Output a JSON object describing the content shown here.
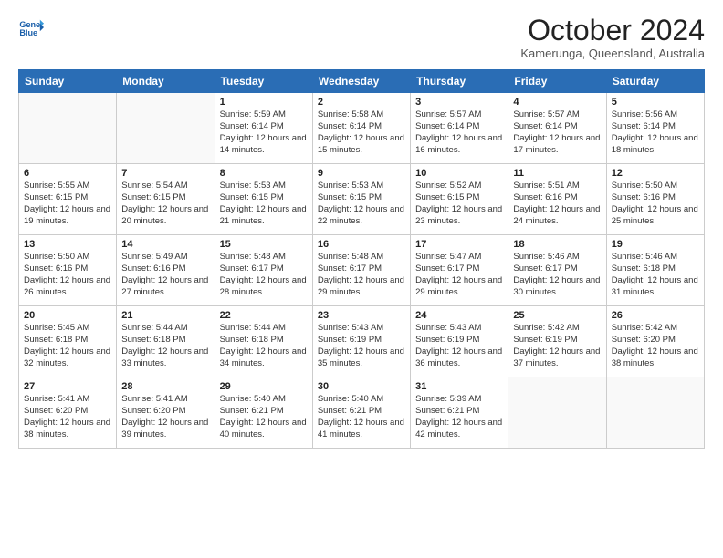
{
  "logo": {
    "line1": "General",
    "line2": "Blue"
  },
  "title": "October 2024",
  "subtitle": "Kamerunga, Queensland, Australia",
  "headers": [
    "Sunday",
    "Monday",
    "Tuesday",
    "Wednesday",
    "Thursday",
    "Friday",
    "Saturday"
  ],
  "weeks": [
    [
      {
        "day": "",
        "info": ""
      },
      {
        "day": "",
        "info": ""
      },
      {
        "day": "1",
        "info": "Sunrise: 5:59 AM\nSunset: 6:14 PM\nDaylight: 12 hours and 14 minutes."
      },
      {
        "day": "2",
        "info": "Sunrise: 5:58 AM\nSunset: 6:14 PM\nDaylight: 12 hours and 15 minutes."
      },
      {
        "day": "3",
        "info": "Sunrise: 5:57 AM\nSunset: 6:14 PM\nDaylight: 12 hours and 16 minutes."
      },
      {
        "day": "4",
        "info": "Sunrise: 5:57 AM\nSunset: 6:14 PM\nDaylight: 12 hours and 17 minutes."
      },
      {
        "day": "5",
        "info": "Sunrise: 5:56 AM\nSunset: 6:14 PM\nDaylight: 12 hours and 18 minutes."
      }
    ],
    [
      {
        "day": "6",
        "info": "Sunrise: 5:55 AM\nSunset: 6:15 PM\nDaylight: 12 hours and 19 minutes."
      },
      {
        "day": "7",
        "info": "Sunrise: 5:54 AM\nSunset: 6:15 PM\nDaylight: 12 hours and 20 minutes."
      },
      {
        "day": "8",
        "info": "Sunrise: 5:53 AM\nSunset: 6:15 PM\nDaylight: 12 hours and 21 minutes."
      },
      {
        "day": "9",
        "info": "Sunrise: 5:53 AM\nSunset: 6:15 PM\nDaylight: 12 hours and 22 minutes."
      },
      {
        "day": "10",
        "info": "Sunrise: 5:52 AM\nSunset: 6:15 PM\nDaylight: 12 hours and 23 minutes."
      },
      {
        "day": "11",
        "info": "Sunrise: 5:51 AM\nSunset: 6:16 PM\nDaylight: 12 hours and 24 minutes."
      },
      {
        "day": "12",
        "info": "Sunrise: 5:50 AM\nSunset: 6:16 PM\nDaylight: 12 hours and 25 minutes."
      }
    ],
    [
      {
        "day": "13",
        "info": "Sunrise: 5:50 AM\nSunset: 6:16 PM\nDaylight: 12 hours and 26 minutes."
      },
      {
        "day": "14",
        "info": "Sunrise: 5:49 AM\nSunset: 6:16 PM\nDaylight: 12 hours and 27 minutes."
      },
      {
        "day": "15",
        "info": "Sunrise: 5:48 AM\nSunset: 6:17 PM\nDaylight: 12 hours and 28 minutes."
      },
      {
        "day": "16",
        "info": "Sunrise: 5:48 AM\nSunset: 6:17 PM\nDaylight: 12 hours and 29 minutes."
      },
      {
        "day": "17",
        "info": "Sunrise: 5:47 AM\nSunset: 6:17 PM\nDaylight: 12 hours and 29 minutes."
      },
      {
        "day": "18",
        "info": "Sunrise: 5:46 AM\nSunset: 6:17 PM\nDaylight: 12 hours and 30 minutes."
      },
      {
        "day": "19",
        "info": "Sunrise: 5:46 AM\nSunset: 6:18 PM\nDaylight: 12 hours and 31 minutes."
      }
    ],
    [
      {
        "day": "20",
        "info": "Sunrise: 5:45 AM\nSunset: 6:18 PM\nDaylight: 12 hours and 32 minutes."
      },
      {
        "day": "21",
        "info": "Sunrise: 5:44 AM\nSunset: 6:18 PM\nDaylight: 12 hours and 33 minutes."
      },
      {
        "day": "22",
        "info": "Sunrise: 5:44 AM\nSunset: 6:18 PM\nDaylight: 12 hours and 34 minutes."
      },
      {
        "day": "23",
        "info": "Sunrise: 5:43 AM\nSunset: 6:19 PM\nDaylight: 12 hours and 35 minutes."
      },
      {
        "day": "24",
        "info": "Sunrise: 5:43 AM\nSunset: 6:19 PM\nDaylight: 12 hours and 36 minutes."
      },
      {
        "day": "25",
        "info": "Sunrise: 5:42 AM\nSunset: 6:19 PM\nDaylight: 12 hours and 37 minutes."
      },
      {
        "day": "26",
        "info": "Sunrise: 5:42 AM\nSunset: 6:20 PM\nDaylight: 12 hours and 38 minutes."
      }
    ],
    [
      {
        "day": "27",
        "info": "Sunrise: 5:41 AM\nSunset: 6:20 PM\nDaylight: 12 hours and 38 minutes."
      },
      {
        "day": "28",
        "info": "Sunrise: 5:41 AM\nSunset: 6:20 PM\nDaylight: 12 hours and 39 minutes."
      },
      {
        "day": "29",
        "info": "Sunrise: 5:40 AM\nSunset: 6:21 PM\nDaylight: 12 hours and 40 minutes."
      },
      {
        "day": "30",
        "info": "Sunrise: 5:40 AM\nSunset: 6:21 PM\nDaylight: 12 hours and 41 minutes."
      },
      {
        "day": "31",
        "info": "Sunrise: 5:39 AM\nSunset: 6:21 PM\nDaylight: 12 hours and 42 minutes."
      },
      {
        "day": "",
        "info": ""
      },
      {
        "day": "",
        "info": ""
      }
    ]
  ]
}
